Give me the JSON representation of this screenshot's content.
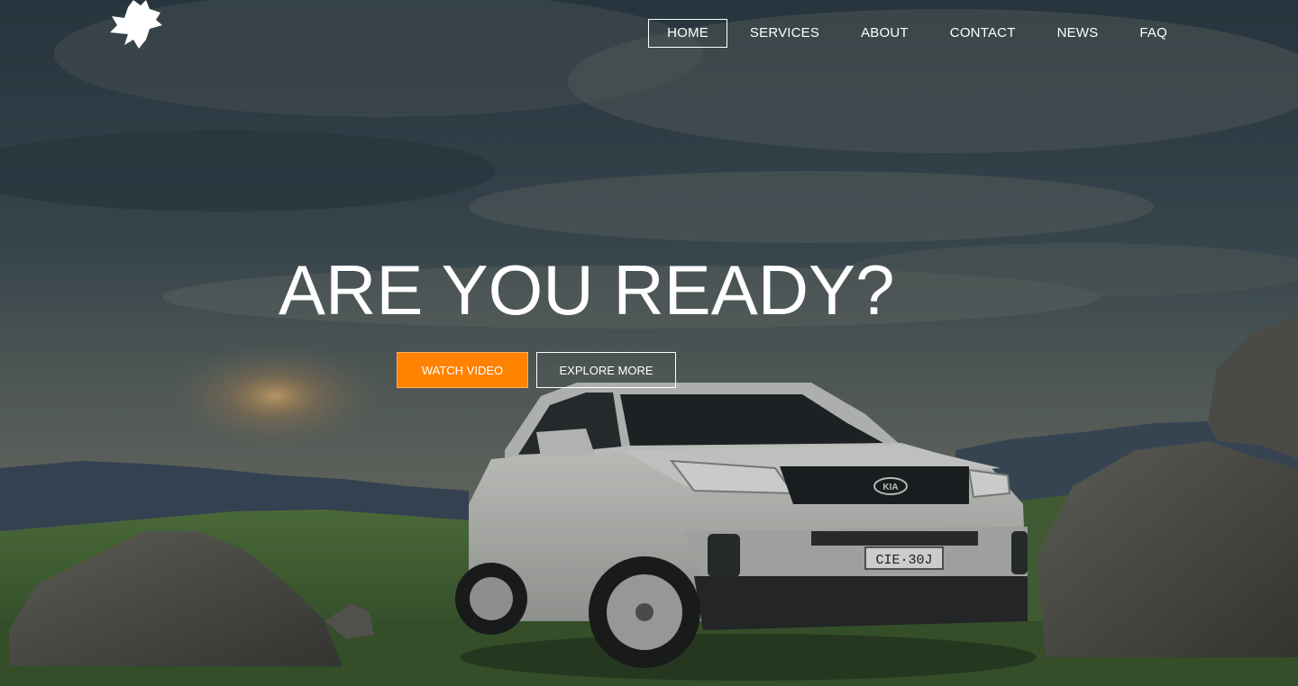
{
  "nav": {
    "items": [
      {
        "label": "HOME",
        "active": true
      },
      {
        "label": "SERVICES",
        "active": false
      },
      {
        "label": "ABOUT",
        "active": false
      },
      {
        "label": "CONTACT",
        "active": false
      },
      {
        "label": "NEWS",
        "active": false
      },
      {
        "label": "FAQ",
        "active": false
      }
    ]
  },
  "hero": {
    "headline": "ARE YOU READY?",
    "watch_label": "WATCH VIDEO",
    "explore_label": "EXPLORE MORE",
    "car_plate": "CIE·30J",
    "car_badge": "KIA"
  },
  "logo": {
    "icon": "bird-logo-icon"
  },
  "colors": {
    "accent": "#ff8200",
    "text": "#ffffff",
    "sky_dark": "#2f3d48",
    "grass": "#3f6a32"
  }
}
